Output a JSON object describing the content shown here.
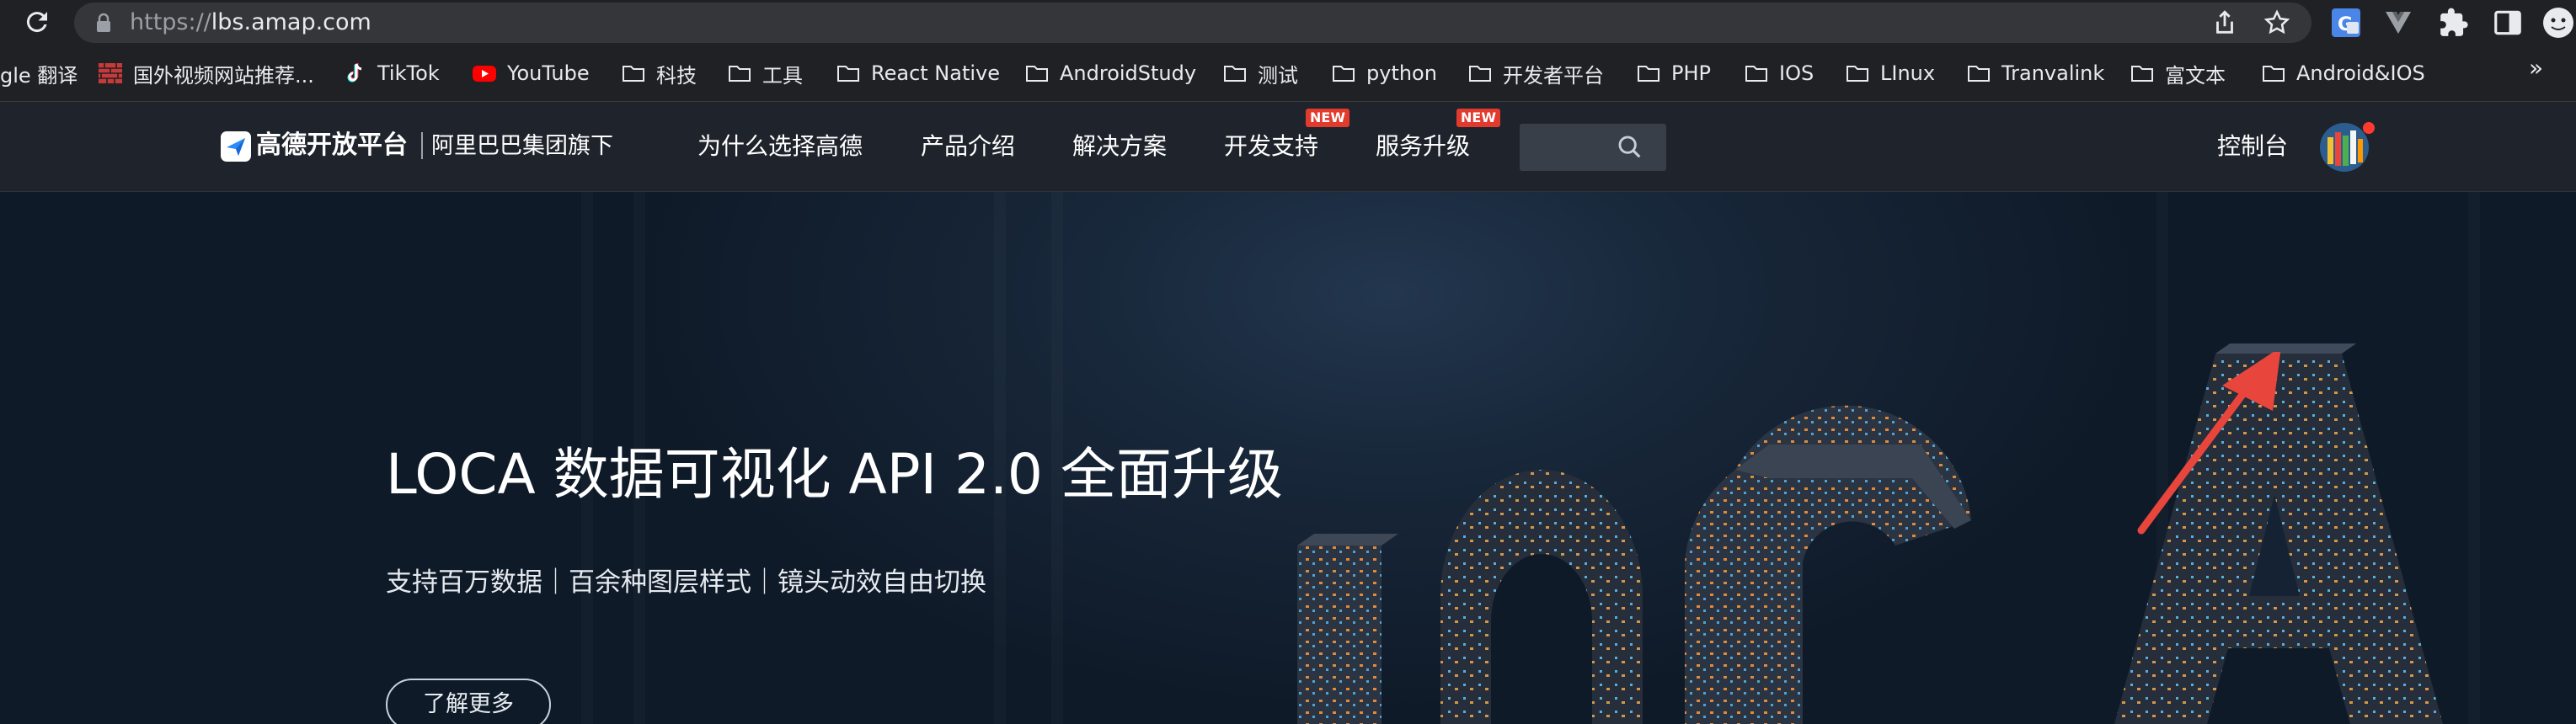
{
  "browser": {
    "url_scheme": "https://",
    "url_host": "lbs.amap.com"
  },
  "bookmarks": [
    {
      "label": "gle 翻译",
      "icon": "google-translate-icon"
    },
    {
      "label": "国外视频网站推荐...",
      "icon": "brick-wall-icon"
    },
    {
      "label": "TikTok",
      "icon": "tiktok-icon"
    },
    {
      "label": "YouTube",
      "icon": "youtube-icon"
    },
    {
      "label": "科技",
      "icon": "folder-icon"
    },
    {
      "label": "工具",
      "icon": "folder-icon"
    },
    {
      "label": "React Native",
      "icon": "folder-icon"
    },
    {
      "label": "AndroidStudy",
      "icon": "folder-icon"
    },
    {
      "label": "测试",
      "icon": "folder-icon"
    },
    {
      "label": "python",
      "icon": "folder-icon"
    },
    {
      "label": "开发者平台",
      "icon": "folder-icon"
    },
    {
      "label": "PHP",
      "icon": "folder-icon"
    },
    {
      "label": "IOS",
      "icon": "folder-icon"
    },
    {
      "label": "LInux",
      "icon": "folder-icon"
    },
    {
      "label": "Tranvalink",
      "icon": "folder-icon"
    },
    {
      "label": "富文本",
      "icon": "folder-icon"
    },
    {
      "label": "Android&IOS",
      "icon": "folder-icon"
    }
  ],
  "bookmarks_more": "»",
  "site": {
    "logo_text": "高德开放平台",
    "logo_sub": "阿里巴巴集团旗下",
    "nav": [
      {
        "label": "为什么选择高德",
        "badge": ""
      },
      {
        "label": "产品介绍",
        "badge": ""
      },
      {
        "label": "解决方案",
        "badge": ""
      },
      {
        "label": "开发支持",
        "badge": "NEW"
      },
      {
        "label": "服务升级",
        "badge": "NEW"
      }
    ],
    "console_label": "控制台"
  },
  "hero": {
    "title": "LOCA 数据可视化 API 2.0 全面升级",
    "subtitle": "支持百万数据｜百余种图层样式｜镜头动效自由切换",
    "button_label": "了解更多"
  },
  "colors": {
    "badge_red": "#e23b2e",
    "annotation_arrow": "#e8453c",
    "header_bg": "#1f242c",
    "hero_bg": "#0f1a28"
  }
}
